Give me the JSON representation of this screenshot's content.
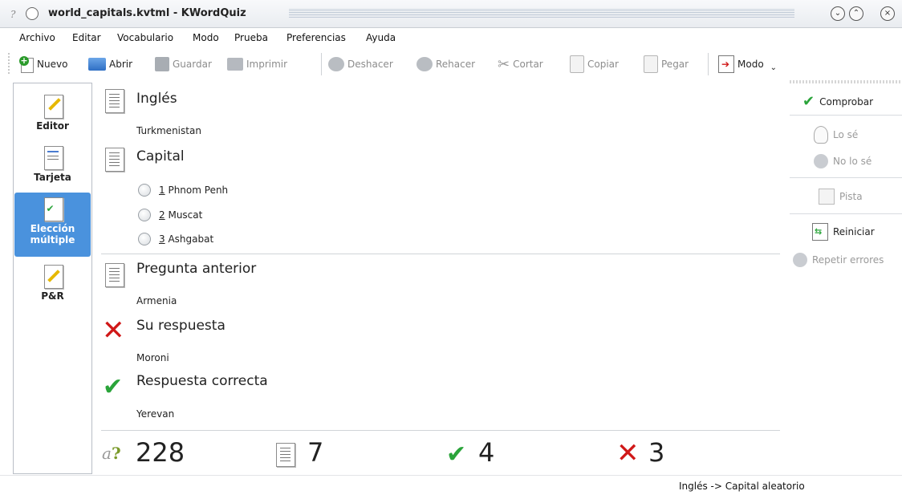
{
  "window": {
    "title": "world_capitals.kvtml - KWordQuiz",
    "app_icon": "?"
  },
  "menu": [
    {
      "label": "Archivo"
    },
    {
      "label": "Editar"
    },
    {
      "label": "Vocabulario"
    },
    {
      "label": "Modo"
    },
    {
      "label": "Prueba"
    },
    {
      "label": "Preferencias"
    },
    {
      "label": "Ayuda"
    }
  ],
  "toolbar": {
    "new": "Nuevo",
    "open": "Abrir",
    "save": "Guardar",
    "print": "Imprimir",
    "undo": "Deshacer",
    "redo": "Rehacer",
    "cut": "Cortar",
    "copy": "Copiar",
    "paste": "Pegar",
    "mode": "Modo"
  },
  "sidebar": {
    "items": [
      {
        "label": "Editor"
      },
      {
        "label": "Tarjeta"
      },
      {
        "label": "Elección múltiple"
      },
      {
        "label": "P&R"
      }
    ],
    "active_index": 2
  },
  "quiz": {
    "question_header": "Inglés",
    "question": "Turkmenistan",
    "answer_header": "Capital",
    "options": [
      {
        "num": "1",
        "text": "Phnom Penh"
      },
      {
        "num": "2",
        "text": "Muscat"
      },
      {
        "num": "3",
        "text": "Ashgabat"
      }
    ],
    "prev_header": "Pregunta anterior",
    "prev_question": "Armenia",
    "your_answer_header": "Su respuesta",
    "your_answer": "Moroni",
    "correct_header": "Respuesta correcta",
    "correct_answer": "Yerevan"
  },
  "score": {
    "total": "228",
    "questions": "7",
    "correct": "4",
    "wrong": "3"
  },
  "right_panel": {
    "check": "Comprobar",
    "know": "Lo sé",
    "dont_know": "No lo sé",
    "hint": "Pista",
    "restart": "Reiniciar",
    "repeat_errors": "Repetir errores"
  },
  "status": {
    "mode": "Inglés -> Capital aleatorio"
  },
  "colors": {
    "accent": "#4a92dd",
    "correct_green": "#2aa43a",
    "wrong_red": "#d01818"
  }
}
